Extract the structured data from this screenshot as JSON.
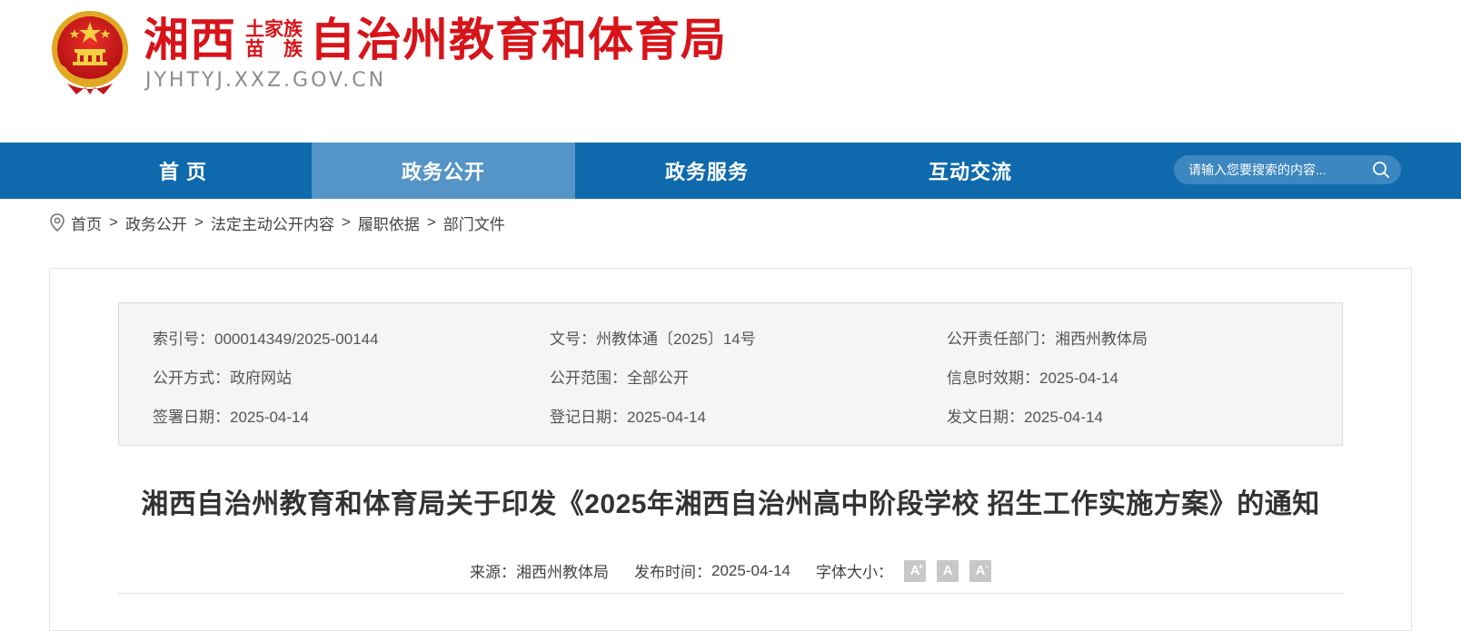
{
  "header": {
    "emblem_icon": "national-emblem-icon",
    "title_part1": "湘西",
    "title_stack_top": "土家族",
    "title_stack_bottom_left": "苗",
    "title_stack_bottom_right": "族",
    "title_part2": "自治州教育和体育局",
    "domain": "JYHTYJ.XXZ.GOV.CN",
    "brand_color": "#d7141a"
  },
  "nav": {
    "background": "#0e6aad",
    "active_background": "#5594c7",
    "items": [
      {
        "label": "首 页"
      },
      {
        "label": "政务公开"
      },
      {
        "label": "政务服务"
      },
      {
        "label": "互动交流"
      }
    ],
    "active_index": 1,
    "search": {
      "placeholder": "请输入您要搜索的内容...",
      "icon": "search-icon"
    }
  },
  "breadcrumb": {
    "icon": "location-pin-icon",
    "items": [
      "首页",
      "政务公开",
      "法定主动公开内容",
      "履职依据",
      "部门文件"
    ],
    "separator": ">"
  },
  "meta": {
    "rows": [
      [
        {
          "label": "索引号：",
          "value": "000014349/2025-00144"
        },
        {
          "label": "文号：",
          "value": "州教体通〔2025〕14号"
        },
        {
          "label": "公开责任部门：",
          "value": "湘西州教体局"
        }
      ],
      [
        {
          "label": "公开方式：",
          "value": "政府网站"
        },
        {
          "label": "公开范围：",
          "value": "全部公开"
        },
        {
          "label": "信息时效期：",
          "value": "2025-04-14"
        }
      ],
      [
        {
          "label": "签署日期：",
          "value": "2025-04-14"
        },
        {
          "label": "登记日期：",
          "value": "2025-04-14"
        },
        {
          "label": "发文日期：",
          "value": "2025-04-14"
        }
      ]
    ]
  },
  "article": {
    "title": "湘西自治州教育和体育局关于印发《2025年湘西自治州高中阶段学校 招生工作实施方案》的通知",
    "source_label": "来源：",
    "source_value": "湘西州教体局",
    "publish_label": "发布时间：",
    "publish_value": "2025-04-14",
    "font_size_label": "字体大小：",
    "font_buttons": [
      {
        "letter": "A",
        "sup": "+"
      },
      {
        "letter": "A",
        "sup": ""
      },
      {
        "letter": "A",
        "sup": "-"
      }
    ]
  }
}
